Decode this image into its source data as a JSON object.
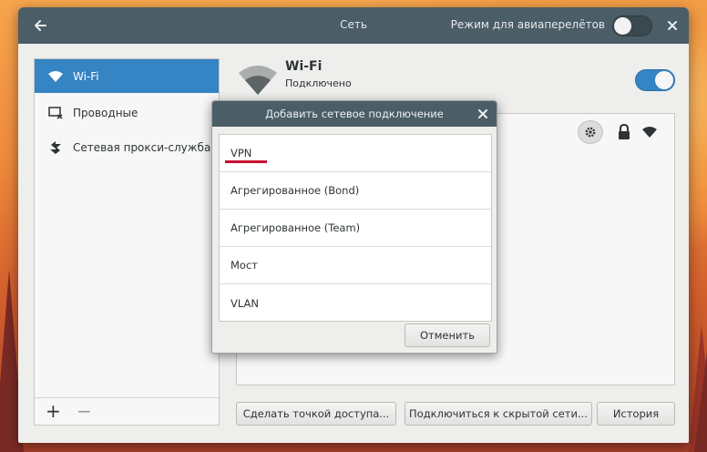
{
  "window": {
    "title": "Сеть",
    "airplane_mode_label": "Режим для авиаперелётов",
    "airplane_mode_enabled": false
  },
  "sidebar": {
    "items": [
      {
        "label": "Wi-Fi",
        "icon": "wifi-icon",
        "active": true
      },
      {
        "label": "Проводные",
        "icon": "wired-network-icon",
        "active": false
      },
      {
        "label": "Сетевая прокси-служба",
        "icon": "proxy-icon",
        "active": false
      }
    ],
    "add_label": "+",
    "remove_label": "−"
  },
  "main": {
    "device_title": "Wi-Fi",
    "device_status": "Подключено",
    "wifi_enabled": true,
    "buttons": {
      "hotspot": "Сделать точкой доступа...",
      "hidden_network": "Подключиться к скрытой сети...",
      "history": "История"
    }
  },
  "dialog": {
    "title": "Добавить сетевое подключение",
    "options": [
      "VPN",
      "Агрегированное (Bond)",
      "Агрегированное (Team)",
      "Мост",
      "VLAN"
    ],
    "cancel_label": "Отменить"
  },
  "colors": {
    "headerbar": "#4b5d66",
    "accent": "#3584c4",
    "annotation_underline": "#c8102e"
  }
}
